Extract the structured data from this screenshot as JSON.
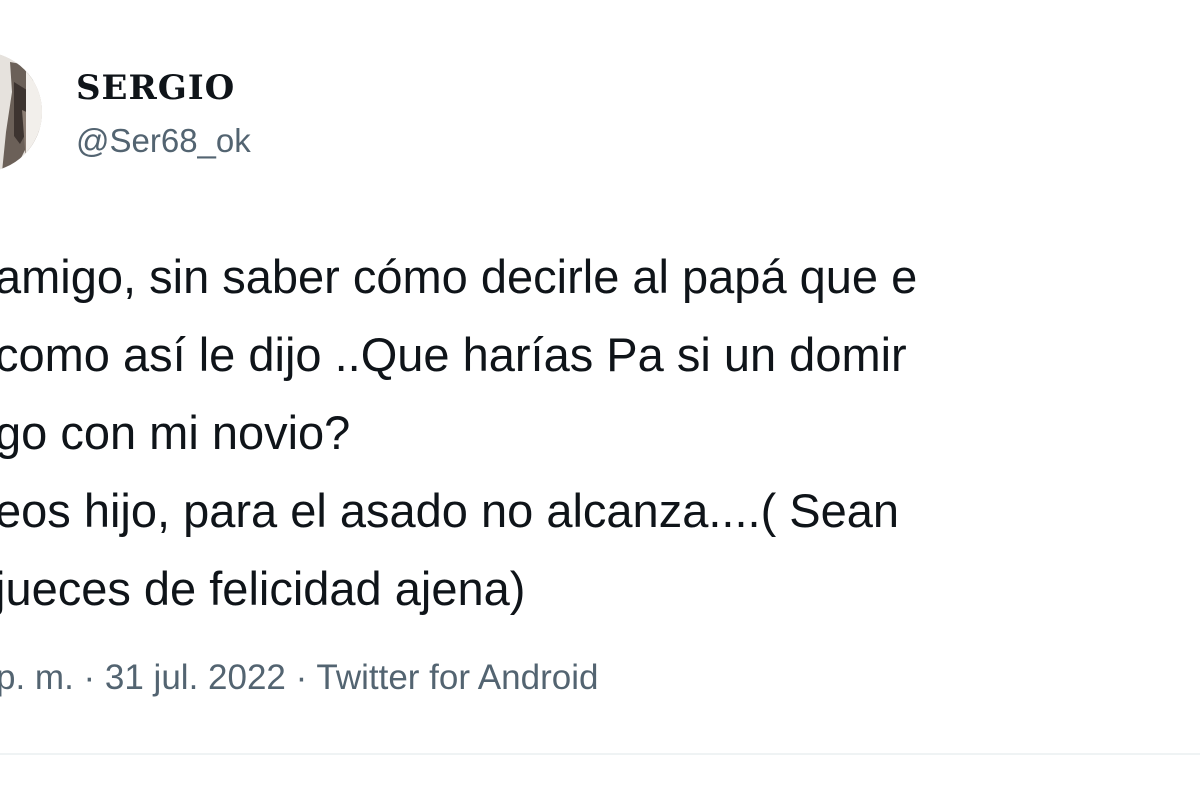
{
  "author": {
    "display_name": "SERGIO",
    "handle": "@Ser68_ok"
  },
  "tweet": {
    "lines": [
      "amigo, sin saber cómo decirle al papá que e",
      " como así le dijo ..Que harías Pa si un domir",
      "go con mi novio?",
      "eos hijo, para el asado no alcanza....( Sean",
      "jueces de felicidad ajena)"
    ]
  },
  "meta": {
    "time": "p. m.",
    "separator_1": " · ",
    "date": "31 jul. 2022",
    "separator_2": " · ",
    "source": "Twitter for Android"
  },
  "colors": {
    "text": "#0f1419",
    "secondary": "#536471",
    "divider": "#eff3f4"
  }
}
